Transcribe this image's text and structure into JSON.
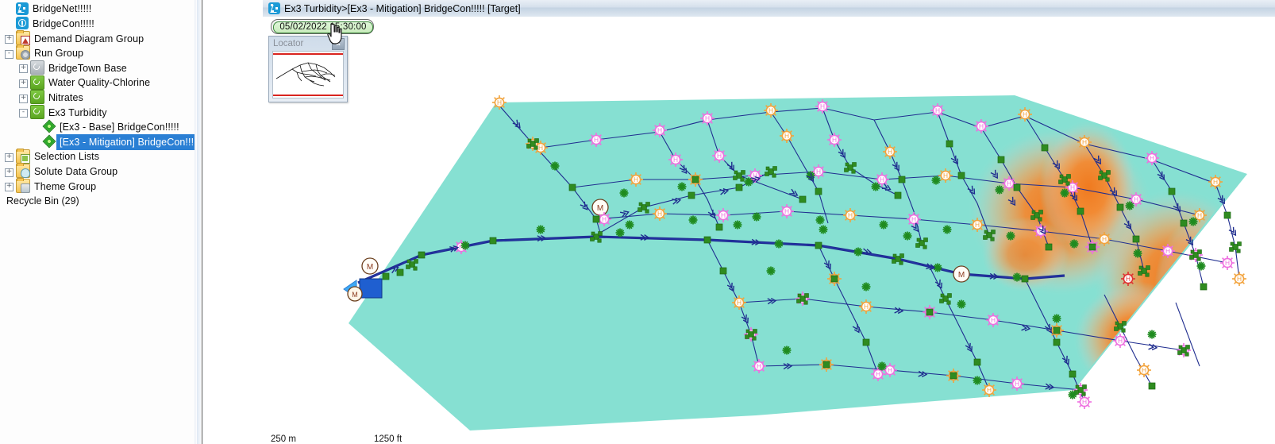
{
  "window": {
    "title": "Ex3 Turbidity>[Ex3 - Mitigation] BridgeCon!!!!!  [Target]",
    "icon": "bridgenet-icon"
  },
  "tree": {
    "items": [
      {
        "label": "BridgeNet!!!!!",
        "icon": "bridgenet-icon",
        "indent": 0,
        "expander": "",
        "selected": false
      },
      {
        "label": "BridgeCon!!!!!",
        "icon": "bridgecon-icon",
        "indent": 0,
        "expander": "",
        "selected": false
      },
      {
        "label": "Demand Diagram Group",
        "icon": "folder-chart-icon",
        "indent": 0,
        "expander": "+",
        "selected": false
      },
      {
        "label": "Run Group",
        "icon": "folder-run-icon",
        "indent": 0,
        "expander": "-",
        "selected": false
      },
      {
        "label": "BridgeTown Base",
        "icon": "run-gray-icon",
        "indent": 1,
        "expander": "+",
        "selected": false
      },
      {
        "label": "Water Quality-Chlorine",
        "icon": "run-green-icon",
        "indent": 1,
        "expander": "+",
        "selected": false
      },
      {
        "label": "Nitrates",
        "icon": "run-green-icon",
        "indent": 1,
        "expander": "+",
        "selected": false
      },
      {
        "label": "Ex3 Turbidity",
        "icon": "run-green-icon",
        "indent": 1,
        "expander": "-",
        "selected": false
      },
      {
        "label": "[Ex3 - Base] BridgeCon!!!!!",
        "icon": "result-diamond-icon",
        "indent": 2,
        "expander": "",
        "selected": false
      },
      {
        "label": "[Ex3 - Mitigation] BridgeCon!!!!!",
        "icon": "result-diamond-icon",
        "indent": 2,
        "expander": "",
        "selected": true
      },
      {
        "label": "Selection Lists",
        "icon": "folder-select-icon",
        "indent": 0,
        "expander": "+",
        "selected": false
      },
      {
        "label": "Solute Data Group",
        "icon": "folder-solute-icon",
        "indent": 0,
        "expander": "+",
        "selected": false
      },
      {
        "label": "Theme Group",
        "icon": "folder-theme-icon",
        "indent": 0,
        "expander": "+",
        "selected": false
      }
    ],
    "recycle_bin": "Recycle Bin (29)"
  },
  "toolbar": {
    "datetime_value": "05/02/2022 15:30:00"
  },
  "locator": {
    "title": "Locator",
    "close_label": "x"
  },
  "scale": {
    "metric_label": "250 m",
    "imperial_label": "1250 ft"
  },
  "colors": {
    "zone_fill": "#86e0d2",
    "pipe": "#1f2d8f",
    "node_green": "#2f8b20",
    "hydrant_pink": "#ee6fe0",
    "hydrant_orange": "#f2a33c",
    "hydrant_red": "#e03030",
    "contour_hot": "#f2802a",
    "selection_blue": "#2a7fd4",
    "title_gradient_top": "#e9eff6",
    "title_gradient_bottom": "#c3d2e2"
  }
}
